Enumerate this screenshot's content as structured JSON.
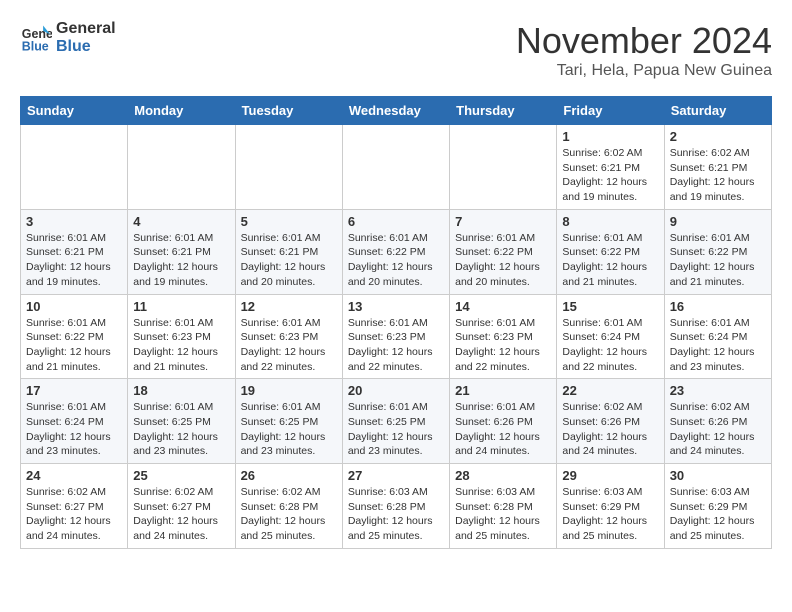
{
  "header": {
    "logo_line1": "General",
    "logo_line2": "Blue",
    "month": "November 2024",
    "location": "Tari, Hela, Papua New Guinea"
  },
  "weekdays": [
    "Sunday",
    "Monday",
    "Tuesday",
    "Wednesday",
    "Thursday",
    "Friday",
    "Saturday"
  ],
  "weeks": [
    [
      {
        "day": "",
        "info": ""
      },
      {
        "day": "",
        "info": ""
      },
      {
        "day": "",
        "info": ""
      },
      {
        "day": "",
        "info": ""
      },
      {
        "day": "",
        "info": ""
      },
      {
        "day": "1",
        "info": "Sunrise: 6:02 AM\nSunset: 6:21 PM\nDaylight: 12 hours and 19 minutes."
      },
      {
        "day": "2",
        "info": "Sunrise: 6:02 AM\nSunset: 6:21 PM\nDaylight: 12 hours and 19 minutes."
      }
    ],
    [
      {
        "day": "3",
        "info": "Sunrise: 6:01 AM\nSunset: 6:21 PM\nDaylight: 12 hours and 19 minutes."
      },
      {
        "day": "4",
        "info": "Sunrise: 6:01 AM\nSunset: 6:21 PM\nDaylight: 12 hours and 19 minutes."
      },
      {
        "day": "5",
        "info": "Sunrise: 6:01 AM\nSunset: 6:21 PM\nDaylight: 12 hours and 20 minutes."
      },
      {
        "day": "6",
        "info": "Sunrise: 6:01 AM\nSunset: 6:22 PM\nDaylight: 12 hours and 20 minutes."
      },
      {
        "day": "7",
        "info": "Sunrise: 6:01 AM\nSunset: 6:22 PM\nDaylight: 12 hours and 20 minutes."
      },
      {
        "day": "8",
        "info": "Sunrise: 6:01 AM\nSunset: 6:22 PM\nDaylight: 12 hours and 21 minutes."
      },
      {
        "day": "9",
        "info": "Sunrise: 6:01 AM\nSunset: 6:22 PM\nDaylight: 12 hours and 21 minutes."
      }
    ],
    [
      {
        "day": "10",
        "info": "Sunrise: 6:01 AM\nSunset: 6:22 PM\nDaylight: 12 hours and 21 minutes."
      },
      {
        "day": "11",
        "info": "Sunrise: 6:01 AM\nSunset: 6:23 PM\nDaylight: 12 hours and 21 minutes."
      },
      {
        "day": "12",
        "info": "Sunrise: 6:01 AM\nSunset: 6:23 PM\nDaylight: 12 hours and 22 minutes."
      },
      {
        "day": "13",
        "info": "Sunrise: 6:01 AM\nSunset: 6:23 PM\nDaylight: 12 hours and 22 minutes."
      },
      {
        "day": "14",
        "info": "Sunrise: 6:01 AM\nSunset: 6:23 PM\nDaylight: 12 hours and 22 minutes."
      },
      {
        "day": "15",
        "info": "Sunrise: 6:01 AM\nSunset: 6:24 PM\nDaylight: 12 hours and 22 minutes."
      },
      {
        "day": "16",
        "info": "Sunrise: 6:01 AM\nSunset: 6:24 PM\nDaylight: 12 hours and 23 minutes."
      }
    ],
    [
      {
        "day": "17",
        "info": "Sunrise: 6:01 AM\nSunset: 6:24 PM\nDaylight: 12 hours and 23 minutes."
      },
      {
        "day": "18",
        "info": "Sunrise: 6:01 AM\nSunset: 6:25 PM\nDaylight: 12 hours and 23 minutes."
      },
      {
        "day": "19",
        "info": "Sunrise: 6:01 AM\nSunset: 6:25 PM\nDaylight: 12 hours and 23 minutes."
      },
      {
        "day": "20",
        "info": "Sunrise: 6:01 AM\nSunset: 6:25 PM\nDaylight: 12 hours and 23 minutes."
      },
      {
        "day": "21",
        "info": "Sunrise: 6:01 AM\nSunset: 6:26 PM\nDaylight: 12 hours and 24 minutes."
      },
      {
        "day": "22",
        "info": "Sunrise: 6:02 AM\nSunset: 6:26 PM\nDaylight: 12 hours and 24 minutes."
      },
      {
        "day": "23",
        "info": "Sunrise: 6:02 AM\nSunset: 6:26 PM\nDaylight: 12 hours and 24 minutes."
      }
    ],
    [
      {
        "day": "24",
        "info": "Sunrise: 6:02 AM\nSunset: 6:27 PM\nDaylight: 12 hours and 24 minutes."
      },
      {
        "day": "25",
        "info": "Sunrise: 6:02 AM\nSunset: 6:27 PM\nDaylight: 12 hours and 24 minutes."
      },
      {
        "day": "26",
        "info": "Sunrise: 6:02 AM\nSunset: 6:28 PM\nDaylight: 12 hours and 25 minutes."
      },
      {
        "day": "27",
        "info": "Sunrise: 6:03 AM\nSunset: 6:28 PM\nDaylight: 12 hours and 25 minutes."
      },
      {
        "day": "28",
        "info": "Sunrise: 6:03 AM\nSunset: 6:28 PM\nDaylight: 12 hours and 25 minutes."
      },
      {
        "day": "29",
        "info": "Sunrise: 6:03 AM\nSunset: 6:29 PM\nDaylight: 12 hours and 25 minutes."
      },
      {
        "day": "30",
        "info": "Sunrise: 6:03 AM\nSunset: 6:29 PM\nDaylight: 12 hours and 25 minutes."
      }
    ]
  ]
}
